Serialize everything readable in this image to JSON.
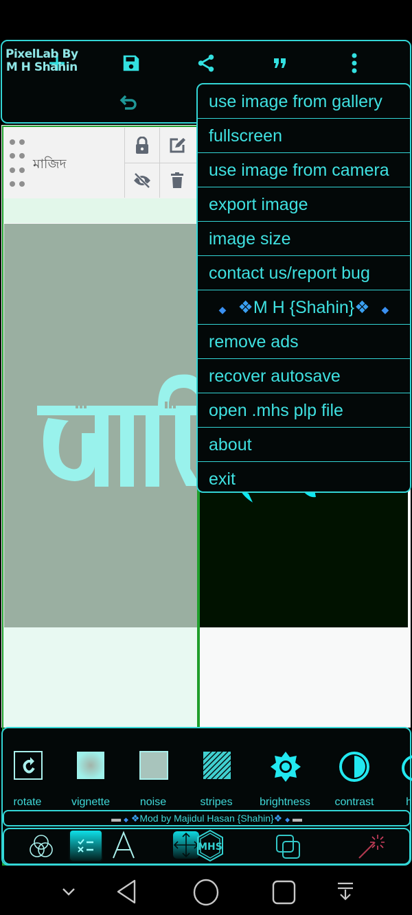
{
  "app": {
    "brand_line1": "PixelLab By",
    "brand_line2": "M H Shahin"
  },
  "toolbar": {
    "icons": [
      "add-icon",
      "save-icon",
      "share-icon",
      "quote-icon",
      "more-vert-icon",
      "undo-icon"
    ]
  },
  "layer": {
    "name": "মাজিদ",
    "actions": [
      "lock-icon",
      "edit-icon",
      "visibility-off-icon",
      "delete-icon"
    ]
  },
  "menu": {
    "items": [
      "use image from gallery",
      "fullscreen",
      "use image from camera",
      "export image",
      "image size",
      "contact us/report bug",
      "M H {Shahin}",
      "remove ads",
      "recover autosave",
      "open .mhs plp file",
      "about",
      "exit"
    ]
  },
  "tools": {
    "items": [
      {
        "label": "rotate",
        "icon": "rotate-icon"
      },
      {
        "label": "vignette",
        "icon": "vignette-icon"
      },
      {
        "label": "noise",
        "icon": "noise-icon"
      },
      {
        "label": "stripes",
        "icon": "stripes-icon"
      },
      {
        "label": "brightness",
        "icon": "brightness-icon"
      },
      {
        "label": "contrast",
        "icon": "contrast-icon"
      },
      {
        "label": "h",
        "icon": "hue-icon"
      }
    ],
    "mod_credit": "Mod by Majidul Hasan {Shahin}"
  },
  "bottom_nav": {
    "icons": [
      "color-blend-icon",
      "checklist-icon",
      "text-icon",
      "move-icon",
      "mhs-logo-icon",
      "layers-icon",
      "magic-wand-icon"
    ]
  },
  "colors": {
    "accent": "#33d6d6",
    "panel_bg": "#030808",
    "layer_border": "#1f9e2c",
    "canvas_overlay": "#9aafa1"
  }
}
